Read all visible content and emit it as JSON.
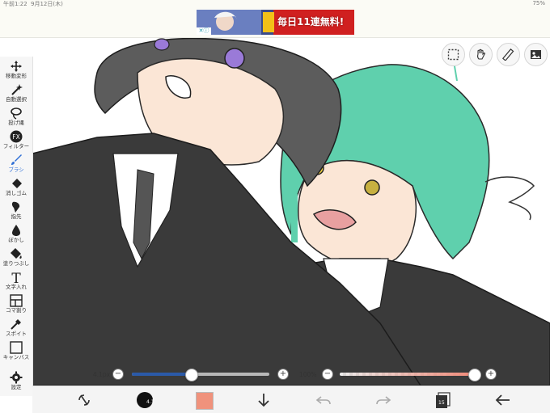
{
  "status_bar": {
    "time": "午前1:22",
    "date": "9月12日(木)",
    "battery": "75%"
  },
  "ad": {
    "text": "毎日11連無料!",
    "badge": "✕ⓘ"
  },
  "left_toolbar": {
    "tools": [
      {
        "label": "移動変形",
        "icon": "move-icon"
      },
      {
        "label": "自動選択",
        "icon": "magic-wand-icon"
      },
      {
        "label": "投げ縄",
        "icon": "lasso-icon"
      },
      {
        "label": "フィルター",
        "icon": "fx-icon"
      },
      {
        "label": "ブラシ",
        "icon": "brush-icon",
        "active": true
      },
      {
        "label": "消しゴム",
        "icon": "eraser-icon"
      },
      {
        "label": "指先",
        "icon": "smudge-icon"
      },
      {
        "label": "ぼかし",
        "icon": "blur-icon"
      },
      {
        "label": "塗りつぶし",
        "icon": "fill-icon"
      },
      {
        "label": "文字入れ",
        "icon": "text-icon"
      },
      {
        "label": "コマ割り",
        "icon": "frame-divider-icon"
      },
      {
        "label": "スポイト",
        "icon": "eyedropper-icon"
      },
      {
        "label": "キャンバス",
        "icon": "canvas-icon"
      },
      {
        "label": "設定",
        "icon": "settings-icon"
      }
    ],
    "accent_color": "#2f6fd6"
  },
  "top_right_buttons": [
    {
      "name": "selection-button",
      "icon": "selection-icon"
    },
    {
      "name": "hand-tool-button",
      "icon": "hand-icon"
    },
    {
      "name": "ruler-button",
      "icon": "ruler-icon"
    },
    {
      "name": "layer-image-button",
      "icon": "image-icon"
    }
  ],
  "brush_size": {
    "label": "4.1px",
    "minus": "−",
    "plus": "+",
    "fill_fraction": 0.43,
    "color": "#2b5aa8"
  },
  "opacity": {
    "label": "100%",
    "minus": "−",
    "plus": "+",
    "fill_fraction": 1.0,
    "color": "#f08a78"
  },
  "bottom_toolbar": {
    "buttons": [
      {
        "name": "transform-button",
        "icon": "transform-icon"
      },
      {
        "name": "brush-preview-button",
        "icon": "brush-preview-icon"
      },
      {
        "name": "color-button",
        "icon": "color-swatch-icon"
      },
      {
        "name": "download-button",
        "icon": "arrow-down-icon"
      },
      {
        "name": "undo-button",
        "icon": "undo-icon"
      },
      {
        "name": "redo-button",
        "icon": "redo-icon"
      },
      {
        "name": "layers-button",
        "icon": "layers-icon"
      },
      {
        "name": "back-button",
        "icon": "arrow-left-icon"
      }
    ],
    "current_color": "#f0927c",
    "layer_count": "15"
  }
}
